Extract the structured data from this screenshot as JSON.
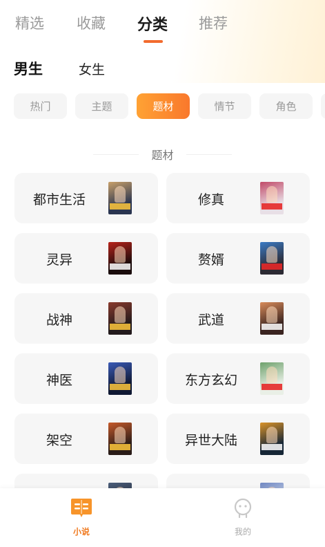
{
  "top_tabs": [
    {
      "label": "精选"
    },
    {
      "label": "收藏"
    },
    {
      "label": "分类"
    },
    {
      "label": "推荐"
    }
  ],
  "active_top_tab": "分类",
  "gender": {
    "male": "男生",
    "female": "女生",
    "active": "男生"
  },
  "chips": [
    {
      "label": "热门"
    },
    {
      "label": "主题"
    },
    {
      "label": "题材"
    },
    {
      "label": "情节"
    },
    {
      "label": "角色"
    }
  ],
  "active_chip": "题材",
  "section_title": "题材",
  "categories": [
    {
      "name": "都市生活",
      "cover_colors": [
        "#2a3550",
        "#c8a06a"
      ]
    },
    {
      "name": "修真",
      "cover_colors": [
        "#e8dfe6",
        "#c14a68"
      ]
    },
    {
      "name": "灵异",
      "cover_colors": [
        "#1a0c0c",
        "#b8241b"
      ]
    },
    {
      "name": "赘婿",
      "cover_colors": [
        "#2c2a33",
        "#3b7bc5"
      ]
    },
    {
      "name": "战神",
      "cover_colors": [
        "#221a1c",
        "#8a3b2d"
      ]
    },
    {
      "name": "武道",
      "cover_colors": [
        "#3a2420",
        "#d88b5a"
      ]
    },
    {
      "name": "神医",
      "cover_colors": [
        "#0f1833",
        "#3b5bb7"
      ]
    },
    {
      "name": "东方玄幻",
      "cover_colors": [
        "#e9efe6",
        "#6ea16c"
      ]
    },
    {
      "name": "架空",
      "cover_colors": [
        "#2a1c18",
        "#c65a2a"
      ]
    },
    {
      "name": "异世大陆",
      "cover_colors": [
        "#162636",
        "#d9932a"
      ]
    },
    {
      "name": "",
      "cover_colors": [
        "#2a2f3d",
        "#4a5d7a"
      ]
    },
    {
      "name": "",
      "cover_colors": [
        "#dfe6f2",
        "#6f87c2"
      ]
    }
  ],
  "bottom_nav": [
    {
      "label": "小说",
      "icon": "book-icon",
      "active": true
    },
    {
      "label": "我的",
      "icon": "profile-icon",
      "active": false
    }
  ],
  "colors": {
    "accent": "#f26b2e",
    "chip_gradient": [
      "#ffa234",
      "#f9782c"
    ],
    "nav_active": "#f07a20"
  }
}
